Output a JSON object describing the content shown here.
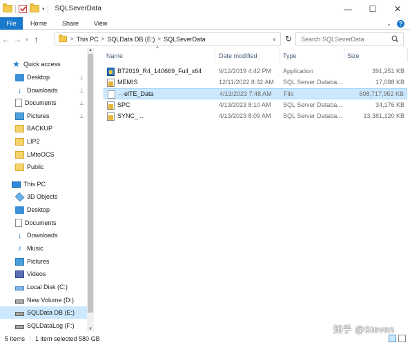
{
  "window": {
    "title": "SQLSeverData",
    "controls": {
      "minimize": "—",
      "maximize": "☐",
      "close": "✕"
    },
    "qat_dropdown": "▾"
  },
  "ribbon": {
    "file_tab": "File",
    "tabs": [
      "Home",
      "Share",
      "View"
    ],
    "expand_glyph": "⌄",
    "help_glyph": "?"
  },
  "nav_buttons": {
    "back": "←",
    "forward": "→",
    "recent": "∨",
    "up": "↑"
  },
  "address": {
    "crumbs": [
      "This PC",
      "SQLData DB (E:)",
      "SQLSeverData"
    ],
    "separator": ">",
    "dropdown": "∨",
    "refresh": "↻"
  },
  "search": {
    "placeholder": "Search SQLSeverData"
  },
  "navpane": {
    "items": [
      {
        "label": "Quick access",
        "icon": "star-icon",
        "pinned": false,
        "selected": false,
        "indent": 0
      },
      {
        "label": "Desktop",
        "icon": "desktop-icon",
        "pinned": true,
        "selected": false,
        "indent": 1
      },
      {
        "label": "Downloads",
        "icon": "download-icon",
        "pinned": true,
        "selected": false,
        "indent": 1
      },
      {
        "label": "Documents",
        "icon": "document-icon",
        "pinned": true,
        "selected": false,
        "indent": 1
      },
      {
        "label": "Pictures",
        "icon": "pictures-icon",
        "pinned": true,
        "selected": false,
        "indent": 1
      },
      {
        "label": "BACKUP",
        "icon": "folder-icon",
        "pinned": false,
        "selected": false,
        "indent": 1
      },
      {
        "label": "LIP2",
        "icon": "folder-icon",
        "pinned": false,
        "selected": false,
        "indent": 1
      },
      {
        "label": "LMtoOCS",
        "icon": "folder-icon",
        "pinned": false,
        "selected": false,
        "indent": 1
      },
      {
        "label": "Public",
        "icon": "folder-icon",
        "pinned": false,
        "selected": false,
        "indent": 1
      },
      {
        "label": "This PC",
        "icon": "pc-icon",
        "pinned": false,
        "selected": false,
        "indent": 0
      },
      {
        "label": "3D Objects",
        "icon": "cube-icon",
        "pinned": false,
        "selected": false,
        "indent": 1
      },
      {
        "label": "Desktop",
        "icon": "desktop-icon",
        "pinned": false,
        "selected": false,
        "indent": 1
      },
      {
        "label": "Documents",
        "icon": "document-icon",
        "pinned": false,
        "selected": false,
        "indent": 1
      },
      {
        "label": "Downloads",
        "icon": "download-icon",
        "pinned": false,
        "selected": false,
        "indent": 1
      },
      {
        "label": "Music",
        "icon": "music-icon",
        "pinned": false,
        "selected": false,
        "indent": 1
      },
      {
        "label": "Pictures",
        "icon": "pictures-icon",
        "pinned": false,
        "selected": false,
        "indent": 1
      },
      {
        "label": "Videos",
        "icon": "video-icon",
        "pinned": false,
        "selected": false,
        "indent": 1
      },
      {
        "label": "Local Disk (C:)",
        "icon": "windows-drive-icon",
        "pinned": false,
        "selected": false,
        "indent": 1
      },
      {
        "label": "New Volume (D:)",
        "icon": "drive-icon",
        "pinned": false,
        "selected": false,
        "indent": 1
      },
      {
        "label": "SQLData DB (E:)",
        "icon": "drive-icon",
        "pinned": false,
        "selected": true,
        "indent": 1
      },
      {
        "label": "SQLDataLog (F:)",
        "icon": "drive-icon",
        "pinned": false,
        "selected": false,
        "indent": 1
      }
    ],
    "pin_glyph": "📌"
  },
  "columns": {
    "name": "Name",
    "date": "Date modified",
    "type": "Type",
    "size": "Size",
    "sort_glyph": "^"
  },
  "files": [
    {
      "name": "BT2019_R4_140669_Full_x64",
      "date": "9/12/2019 4:42 PM",
      "type": "Application",
      "size": "391,251 KB",
      "icon": "application-icon",
      "selected": false
    },
    {
      "name": "MEMIS",
      "date": "12/11/2022 8:32 AM",
      "type": "SQL Server Databa...",
      "size": "17,088 KB",
      "icon": "database-icon",
      "selected": false
    },
    {
      "name": "···elTE_Data",
      "date": "4/13/2023 7:48 AM",
      "type": "File",
      "size": "608,717,952 KB",
      "icon": "file-icon",
      "selected": true
    },
    {
      "name": "SPC",
      "date": "4/13/2023 8:10 AM",
      "type": "SQL Server Databa...",
      "size": "34,176 KB",
      "icon": "database-icon",
      "selected": false
    },
    {
      "name": "SYNC_ ..",
      "date": "4/13/2023 8:09 AM",
      "type": "SQL Server Databa...",
      "size": "13,381,120 KB",
      "icon": "database-icon",
      "selected": false
    }
  ],
  "status": {
    "count": "5 items",
    "selection": "1 item selected  580 GB"
  },
  "watermark": "知乎 @Steven"
}
